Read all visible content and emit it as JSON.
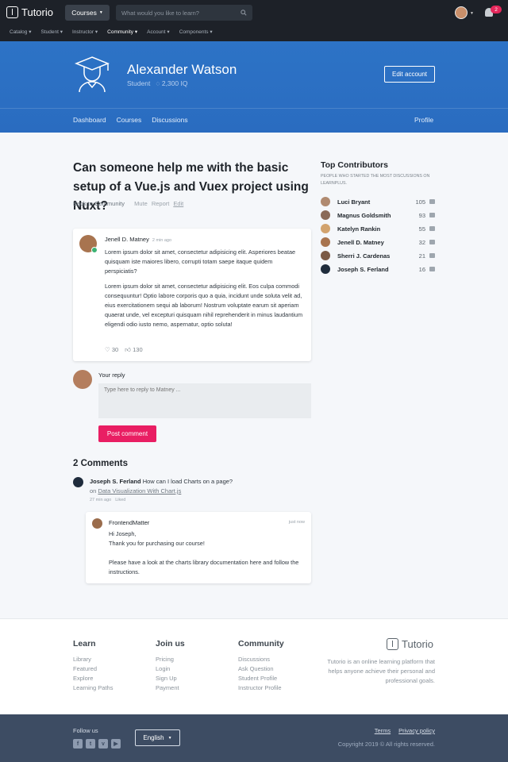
{
  "topbar": {
    "brand": "Tutorio",
    "courses_label": "Courses",
    "search_placeholder": "What would you like to learn?",
    "notification_count": "2",
    "subnav": [
      "Catalog",
      "Student",
      "Instructor",
      "Community",
      "Account",
      "Components"
    ],
    "active_subnav": "Community"
  },
  "hero": {
    "name": "Alexander Watson",
    "role": "Student",
    "iq": "2,300 IQ",
    "edit_label": "Edit account",
    "tabs": [
      "Dashboard",
      "Courses",
      "Discussions"
    ],
    "profile_label": "Profile"
  },
  "discussion": {
    "title": "Can someone help me with the basic setup of a Vue.js and Vuex project using Nuxt?",
    "back": "Back to Community",
    "mute": "Mute",
    "report": "Report",
    "edit": "Edit",
    "author": "Jenell D. Matney",
    "time": "2 min ago",
    "para1": "Lorem ipsum dolor sit amet, consectetur adipisicing elit. Asperiores beatae quisquam iste maiores libero, corrupti totam saepe itaque quidem perspiciatis?",
    "para2": "Lorem ipsum dolor sit amet, consectetur adipisicing elit. Eos culpa commodi consequuntur! Optio labore corporis quo a quia, incidunt unde soluta velit ad, eius exercitationem sequi ab laborum! Nostrum voluptate earum sit aperiam quaerat unde, vel excepturi quisquam nihil reprehenderit in minus laudantium eligendi odio iusto nemo, aspernatur, optio soluta!",
    "likes": "30",
    "thumbs": "130"
  },
  "reply": {
    "label": "Your reply",
    "placeholder": "Type here to reply to Matney ...",
    "button": "Post comment"
  },
  "comments": {
    "heading": "2 Comments",
    "c1_author": "Joseph S. Ferland",
    "c1_text": "How can I load Charts on a page?",
    "c1_on": "on",
    "c1_link": "Data Visualization With Chart.js",
    "c1_time": "27 min ago",
    "c1_liked": "Liked",
    "c2_author": "FrontendMatter",
    "c2_time": "just now",
    "c2_text": "Hi Joseph,\nThank you for purchasing our course!\n\nPlease have a look at the charts library documentation here and follow the instructions."
  },
  "contributors": {
    "heading": "Top Contributors",
    "subheading": "People who started the most discussions on LearnPlus.",
    "list": [
      {
        "name": "Luci Bryant",
        "count": "105",
        "color": "#b08a70"
      },
      {
        "name": "Magnus Goldsmith",
        "count": "93",
        "color": "#8a6a58"
      },
      {
        "name": "Katelyn Rankin",
        "count": "55",
        "color": "#d2a36e"
      },
      {
        "name": "Jenell D. Matney",
        "count": "32",
        "color": "#a8744f"
      },
      {
        "name": "Sherri J. Cardenas",
        "count": "21",
        "color": "#7b5a46"
      },
      {
        "name": "Joseph S. Ferland",
        "count": "16",
        "color": "#1f2c3c"
      }
    ]
  },
  "footer": {
    "learn_h": "Learn",
    "learn": [
      "Library",
      "Featured",
      "Explore",
      "Learning Paths"
    ],
    "join_h": "Join us",
    "join": [
      "Pricing",
      "Login",
      "Sign Up",
      "Payment"
    ],
    "community_h": "Community",
    "community": [
      "Discussions",
      "Ask Question",
      "Student Profile",
      "Instructor Profile"
    ],
    "brand": "Tutorio",
    "description": "Tutorio is an online learning platform that helps anyone achieve their personal and professional goals.",
    "follow": "Follow us",
    "language": "English",
    "terms": "Terms",
    "privacy": "Privacy policy",
    "copyright": "Copyright 2019 © All rights reserved."
  }
}
